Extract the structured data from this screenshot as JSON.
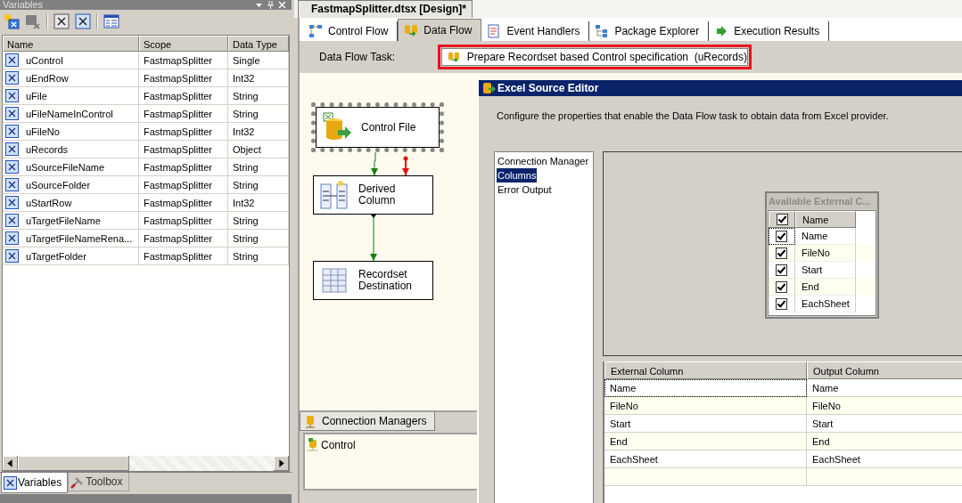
{
  "variables_panel": {
    "title": "Variables",
    "columns": [
      "Name",
      "Scope",
      "Data Type"
    ],
    "rows": [
      {
        "name": "uControl",
        "scope": "FastmapSplitter",
        "type": "Single"
      },
      {
        "name": "uEndRow",
        "scope": "FastmapSplitter",
        "type": "Int32"
      },
      {
        "name": "uFile",
        "scope": "FastmapSplitter",
        "type": "String"
      },
      {
        "name": "uFileNameInControl",
        "scope": "FastmapSplitter",
        "type": "String"
      },
      {
        "name": "uFileNo",
        "scope": "FastmapSplitter",
        "type": "Int32"
      },
      {
        "name": "uRecords",
        "scope": "FastmapSplitter",
        "type": "Object"
      },
      {
        "name": "uSourceFileName",
        "scope": "FastmapSplitter",
        "type": "String"
      },
      {
        "name": "uSourceFolder",
        "scope": "FastmapSplitter",
        "type": "String"
      },
      {
        "name": "uStartRow",
        "scope": "FastmapSplitter",
        "type": "Int32"
      },
      {
        "name": "uTargetFileName",
        "scope": "FastmapSplitter",
        "type": "String"
      },
      {
        "name": "uTargetFileNameRena...",
        "scope": "FastmapSplitter",
        "type": "String"
      },
      {
        "name": "uTargetFolder",
        "scope": "FastmapSplitter",
        "type": "String"
      }
    ],
    "tabs": [
      {
        "label": "Variables",
        "selected": true
      },
      {
        "label": "Toolbox",
        "selected": false
      }
    ]
  },
  "document_tab": {
    "title": "FastmapSplitter.dtsx [Design]*"
  },
  "designer_tabs": [
    {
      "label": "Control Flow",
      "selected": false
    },
    {
      "label": "Data Flow",
      "selected": true
    },
    {
      "label": "Event Handlers",
      "selected": false
    },
    {
      "label": "Package Explorer",
      "selected": false
    },
    {
      "label": "Execution Results",
      "selected": false
    }
  ],
  "data_flow_task": {
    "label": "Data Flow Task:",
    "value": "Prepare Recordset based Control specification  (uRecords)"
  },
  "canvas": {
    "components": [
      {
        "label": "Control File",
        "kind": "source",
        "selected": true
      },
      {
        "label": "Derived Column",
        "kind": "transform",
        "selected": false
      },
      {
        "label": "Recordset Destination",
        "kind": "destination",
        "selected": false
      }
    ]
  },
  "connection_managers": {
    "title": "Connection Managers",
    "items": [
      "Control"
    ]
  },
  "editor": {
    "title": "Excel Source Editor",
    "description": "Configure the properties that enable the Data Flow task to obtain data from Excel provider.",
    "nav": [
      {
        "label": "Connection Manager",
        "selected": false
      },
      {
        "label": "Columns",
        "selected": true
      },
      {
        "label": "Error Output",
        "selected": false
      }
    ],
    "available_columns": {
      "title": "Available External C...",
      "header": "Name",
      "header_checked": true,
      "items": [
        {
          "name": "Name",
          "checked": true
        },
        {
          "name": "FileNo",
          "checked": true
        },
        {
          "name": "Start",
          "checked": true
        },
        {
          "name": "End",
          "checked": true
        },
        {
          "name": "EachSheet",
          "checked": true
        }
      ]
    },
    "mapping": {
      "columns": [
        "External Column",
        "Output Column"
      ],
      "rows": [
        [
          "Name",
          "Name"
        ],
        [
          "FileNo",
          "FileNo"
        ],
        [
          "Start",
          "Start"
        ],
        [
          "End",
          "End"
        ],
        [
          "EachSheet",
          "EachSheet"
        ]
      ]
    }
  }
}
